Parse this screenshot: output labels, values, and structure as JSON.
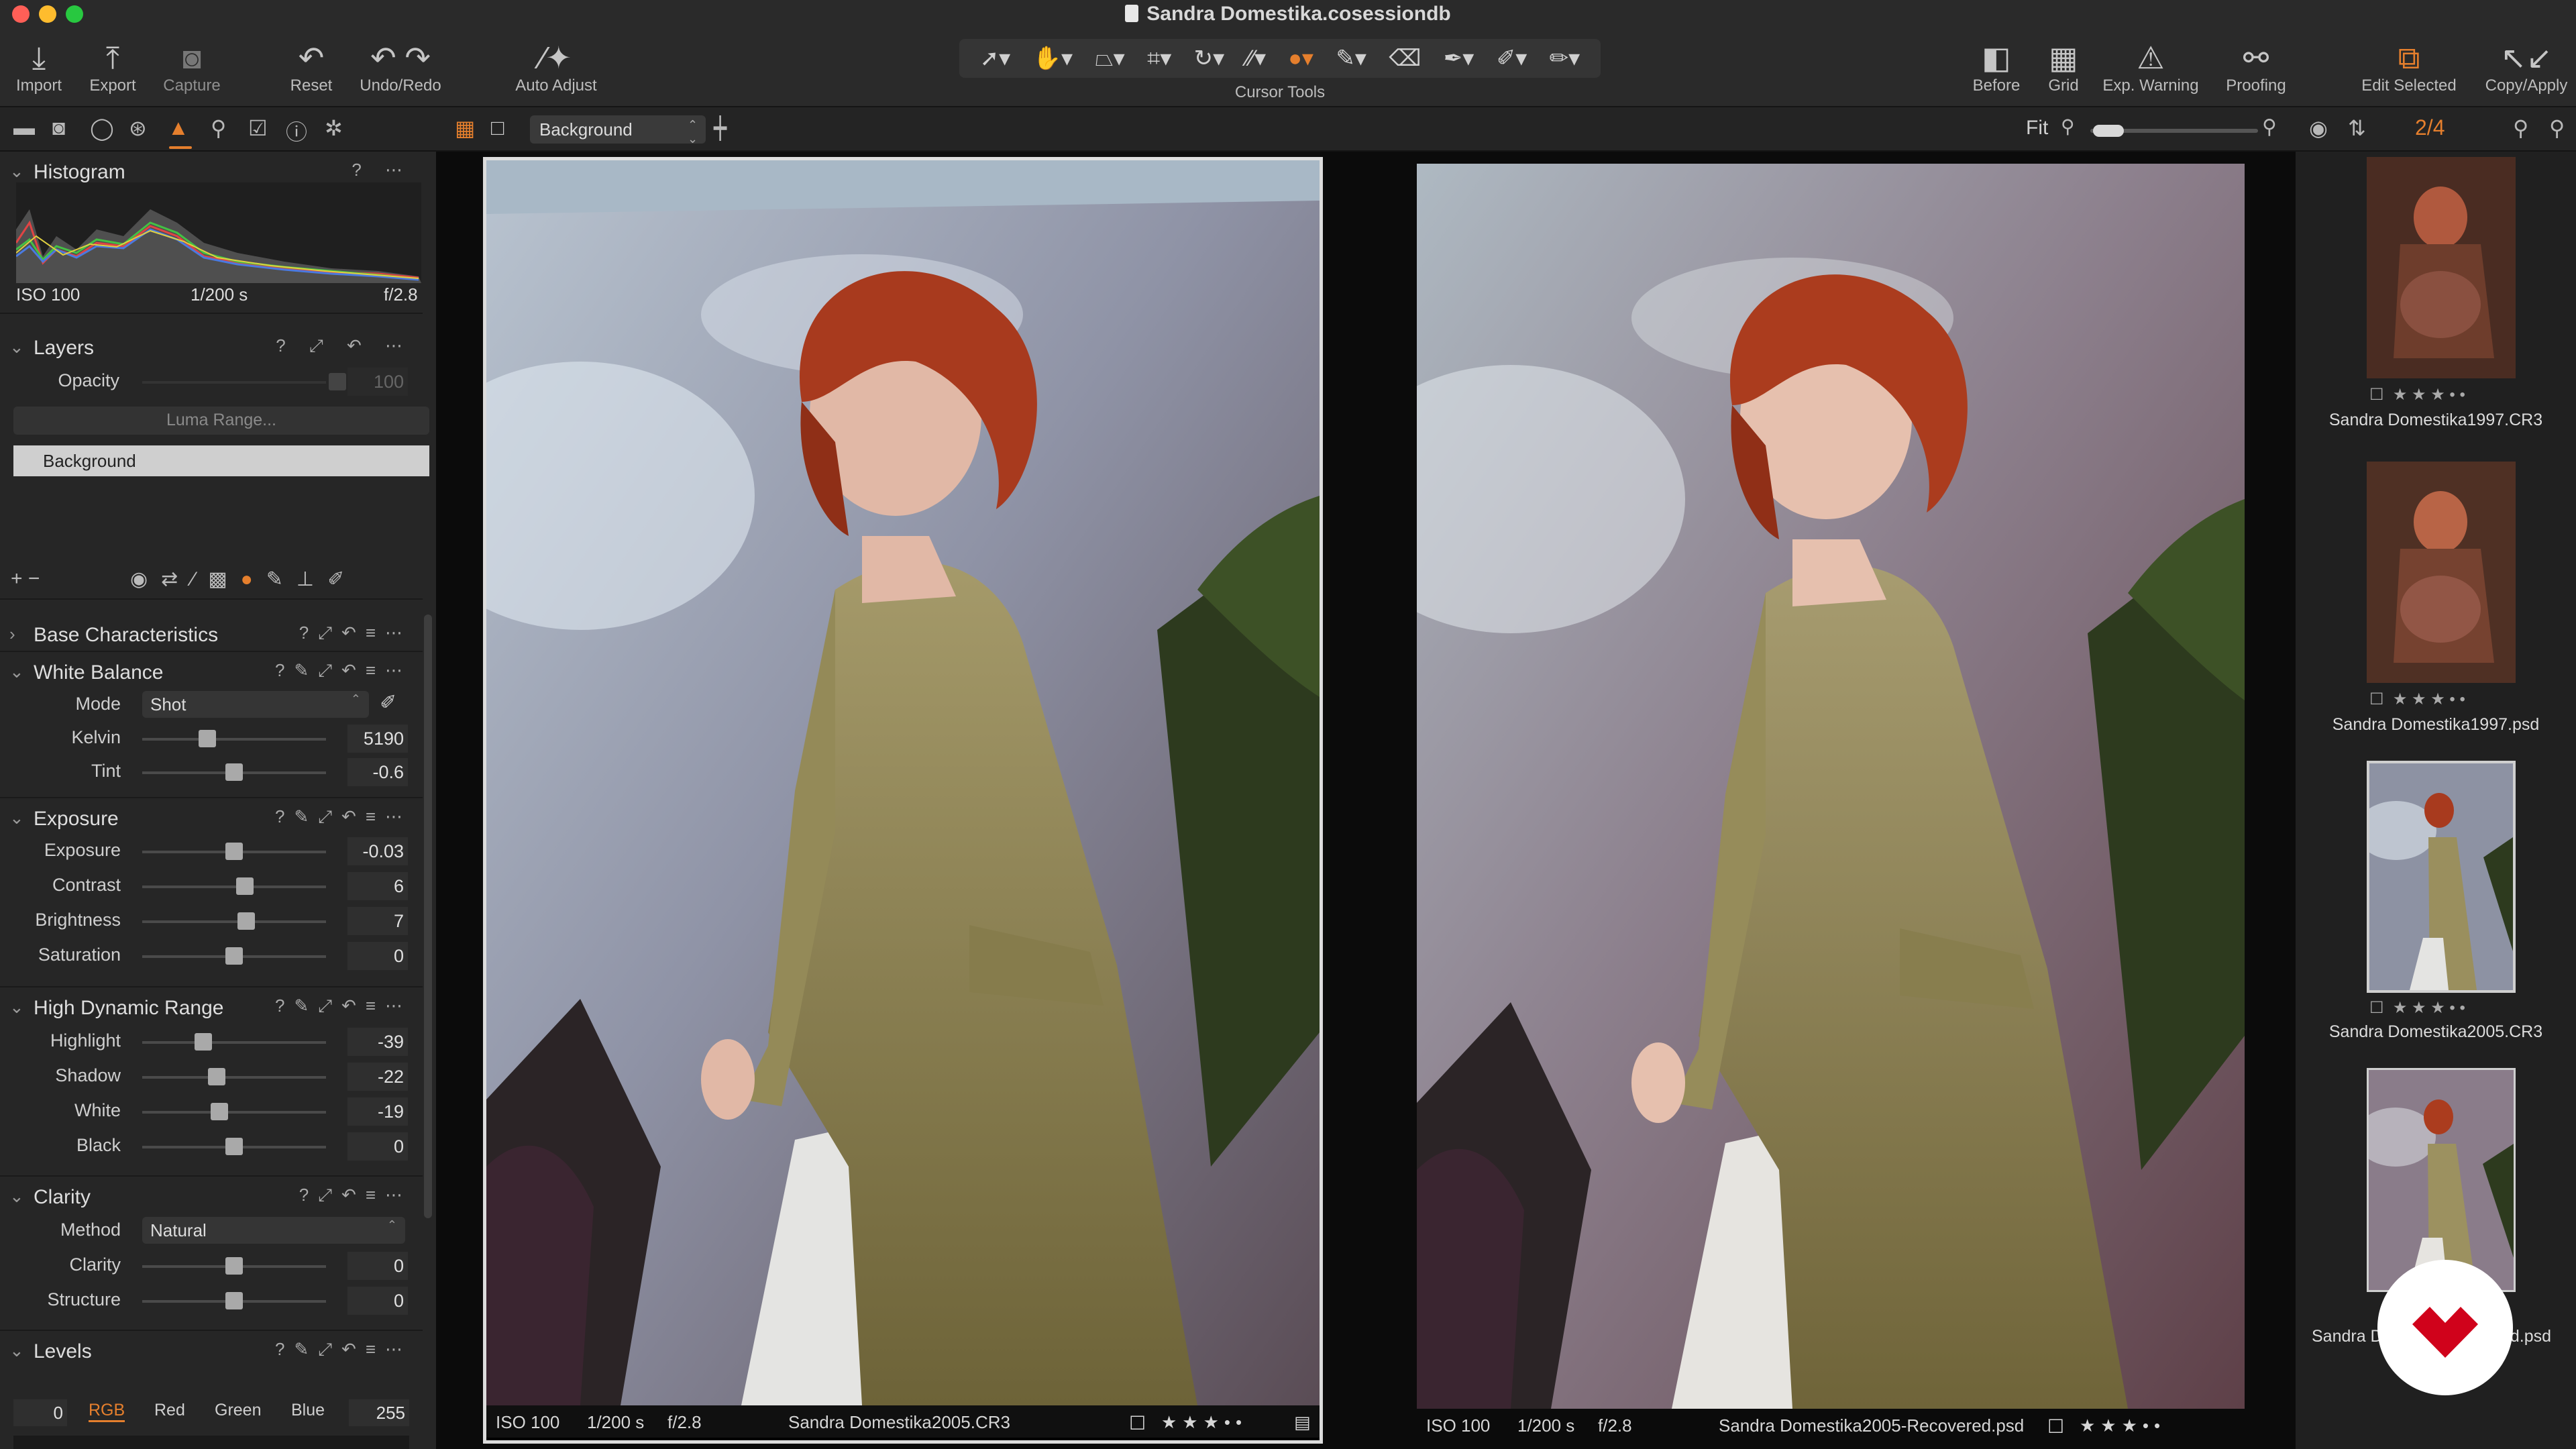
{
  "window": {
    "title": "Sandra Domestika.cosessiondb"
  },
  "toolbar": {
    "import": "Import",
    "export": "Export",
    "capture": "Capture",
    "reset": "Reset",
    "undo_redo": "Undo/Redo",
    "auto_adjust": "Auto Adjust",
    "cursor_tools": "Cursor Tools",
    "before": "Before",
    "grid": "Grid",
    "exp_warning": "Exp. Warning",
    "proofing": "Proofing",
    "edit_selected": "Edit Selected",
    "copy_apply": "Copy/Apply"
  },
  "viewer_bar": {
    "layer": "Background",
    "fit": "Fit",
    "counter": "2/4"
  },
  "histogram": {
    "title": "Histogram",
    "iso": "ISO 100",
    "shutter": "1/200 s",
    "aperture": "f/2.8"
  },
  "layers": {
    "title": "Layers",
    "opacity_label": "Opacity",
    "opacity_value": "100",
    "luma_range": "Luma Range...",
    "background": "Background"
  },
  "base": {
    "title": "Base Characteristics"
  },
  "white_balance": {
    "title": "White Balance",
    "mode_label": "Mode",
    "mode_value": "Shot",
    "kelvin_label": "Kelvin",
    "kelvin_value": "5190",
    "tint_label": "Tint",
    "tint_value": "-0.6"
  },
  "exposure": {
    "title": "Exposure",
    "rows": [
      {
        "label": "Exposure",
        "value": "-0.03"
      },
      {
        "label": "Contrast",
        "value": "6"
      },
      {
        "label": "Brightness",
        "value": "7"
      },
      {
        "label": "Saturation",
        "value": "0"
      }
    ]
  },
  "hdr": {
    "title": "High Dynamic Range",
    "rows": [
      {
        "label": "Highlight",
        "value": "-39"
      },
      {
        "label": "Shadow",
        "value": "-22"
      },
      {
        "label": "White",
        "value": "-19"
      },
      {
        "label": "Black",
        "value": "0"
      }
    ]
  },
  "clarity": {
    "title": "Clarity",
    "method_label": "Method",
    "method_value": "Natural",
    "rows": [
      {
        "label": "Clarity",
        "value": "0"
      },
      {
        "label": "Structure",
        "value": "0"
      }
    ]
  },
  "levels": {
    "title": "Levels",
    "low": "0",
    "high": "255",
    "channels": [
      "RGB",
      "Red",
      "Green",
      "Blue"
    ]
  },
  "viewer": {
    "left": {
      "iso": "ISO 100",
      "shutter": "1/200 s",
      "aperture": "f/2.8",
      "filename": "Sandra Domestika2005.CR3"
    },
    "right": {
      "iso": "ISO 100",
      "shutter": "1/200 s",
      "aperture": "f/2.8",
      "filename": "Sandra Domestika2005-Recovered.psd"
    }
  },
  "filmstrip": {
    "items": [
      {
        "name": "Sandra Domestika1997.CR3"
      },
      {
        "name": "Sandra Domestika1997.psd"
      },
      {
        "name": "Sandra Domestika2005.CR3"
      },
      {
        "name_left": "Sandra D",
        "name_right": "ed.psd"
      }
    ]
  },
  "colors": {
    "accent": "#e57f2d",
    "badge": "#d0021b"
  }
}
